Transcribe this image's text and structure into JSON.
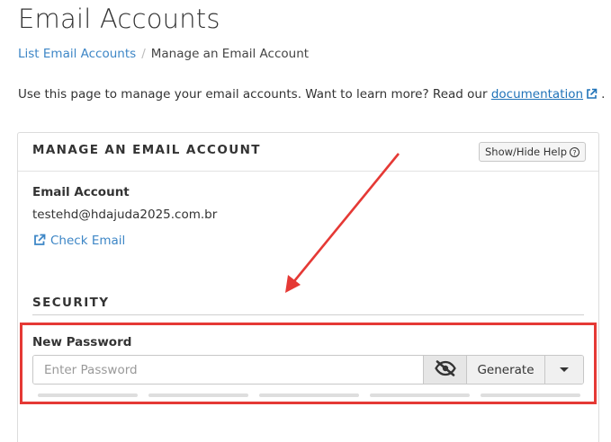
{
  "page": {
    "title": "Email Accounts"
  },
  "breadcrumb": {
    "items": [
      {
        "label": "List Email Accounts",
        "link": true
      },
      {
        "label": "Manage an Email Account",
        "link": false
      }
    ],
    "separator": "/"
  },
  "intro": {
    "text": "Use this page to manage your email accounts. Want to learn more? Read our ",
    "link_label": "documentation",
    "suffix": "."
  },
  "panel": {
    "heading": "MANAGE AN EMAIL ACCOUNT",
    "help_button_label": "Show/Hide Help",
    "help_icon_glyph": "?",
    "email_account_label": "Email Account",
    "email_account_value": "testehd@hdajuda2025.com.br",
    "check_email_label": "Check Email"
  },
  "security": {
    "title": "SECURITY",
    "new_password_label": "New Password",
    "password_value": "",
    "password_placeholder": "Enter Password",
    "generate_label": "Generate",
    "strength_segments": 5,
    "strength_level": 0
  },
  "icons": {
    "external_link": "external-link-icon",
    "visibility_toggle": "eye-slash-icon",
    "dropdown": "caret-down-icon"
  },
  "colors": {
    "link": "#3d86c6",
    "annotation_red": "#e53935",
    "strength_empty": "#dedede"
  }
}
